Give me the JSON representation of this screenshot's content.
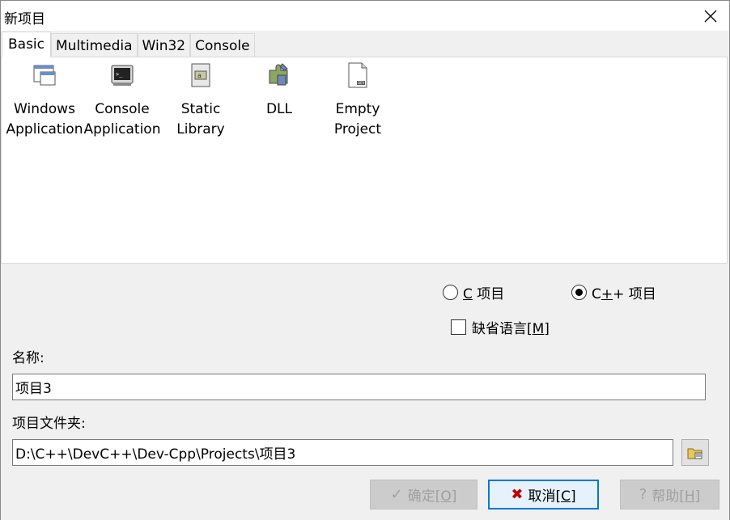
{
  "window": {
    "title": "新项目"
  },
  "tabs": [
    {
      "label": "Basic",
      "active": true
    },
    {
      "label": "Multimedia",
      "active": false
    },
    {
      "label": "Win32",
      "active": false
    },
    {
      "label": "Console",
      "active": false
    }
  ],
  "projects": [
    {
      "label": "Windows\nApplication",
      "icon": "windows-app-icon"
    },
    {
      "label": "Console\nApplication",
      "icon": "console-app-icon"
    },
    {
      "label": "Static\nLibrary",
      "icon": "static-library-icon"
    },
    {
      "label": "DLL",
      "icon": "dll-icon"
    },
    {
      "label": "Empty\nProject",
      "icon": "empty-project-icon"
    }
  ],
  "language": {
    "c_prefix": "C",
    "c_suffix": " 项目",
    "cpp_prefix": "C",
    "cpp_underlined": "+",
    "cpp_suffix": "+ 项目",
    "selected": "cpp",
    "default_lang_label": "缺省语言",
    "default_lang_hotkey": "[M]",
    "default_lang_checked": false
  },
  "name": {
    "label": "名称:",
    "value": "项目3"
  },
  "folder": {
    "label": "项目文件夹:",
    "value": "D:\\C++\\DevC++\\Dev-Cpp\\Projects\\项目3"
  },
  "buttons": {
    "ok": {
      "label": "确定",
      "hotkey": "[O]",
      "enabled": false
    },
    "cancel": {
      "label": "取消",
      "hotkey": "[C]",
      "enabled": true
    },
    "help": {
      "label": "帮助",
      "hotkey": "[H]",
      "enabled": false
    }
  },
  "colors": {
    "accent": "#0078d7",
    "cancel_x": "#c00000",
    "panel_bg": "#ffffff",
    "dialog_bg": "#f0f0f0"
  }
}
